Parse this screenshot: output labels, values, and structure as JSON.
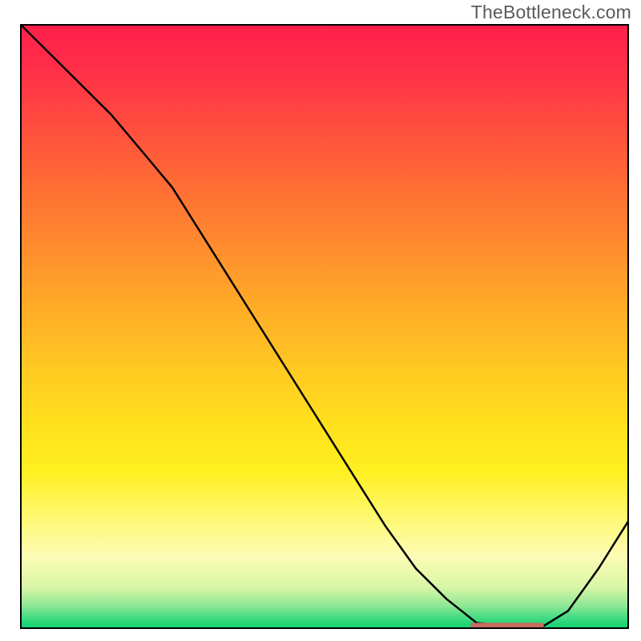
{
  "watermark": "TheBottleneck.com",
  "chart_data": {
    "type": "line",
    "title": "",
    "xlabel": "",
    "ylabel": "",
    "xlim": [
      0,
      100
    ],
    "ylim": [
      0,
      100
    ],
    "series": [
      {
        "name": "curve",
        "x": [
          0,
          5,
          10,
          15,
          20,
          25,
          30,
          35,
          40,
          45,
          50,
          55,
          60,
          65,
          70,
          75,
          80,
          82,
          86,
          90,
          95,
          100
        ],
        "y": [
          100,
          95,
          90,
          85,
          79,
          73,
          65,
          57,
          49,
          41,
          33,
          25,
          17,
          10,
          5,
          1,
          0.5,
          0.5,
          0.5,
          3,
          10,
          18
        ]
      }
    ],
    "marker": {
      "name": "flat-segment",
      "x_start": 74,
      "x_end": 86,
      "y": 0.5,
      "color": "#c66a60"
    },
    "background_gradient": {
      "top": "#ff1f4a",
      "mid": "#ffe01d",
      "bottom": "#0acf6c"
    }
  }
}
